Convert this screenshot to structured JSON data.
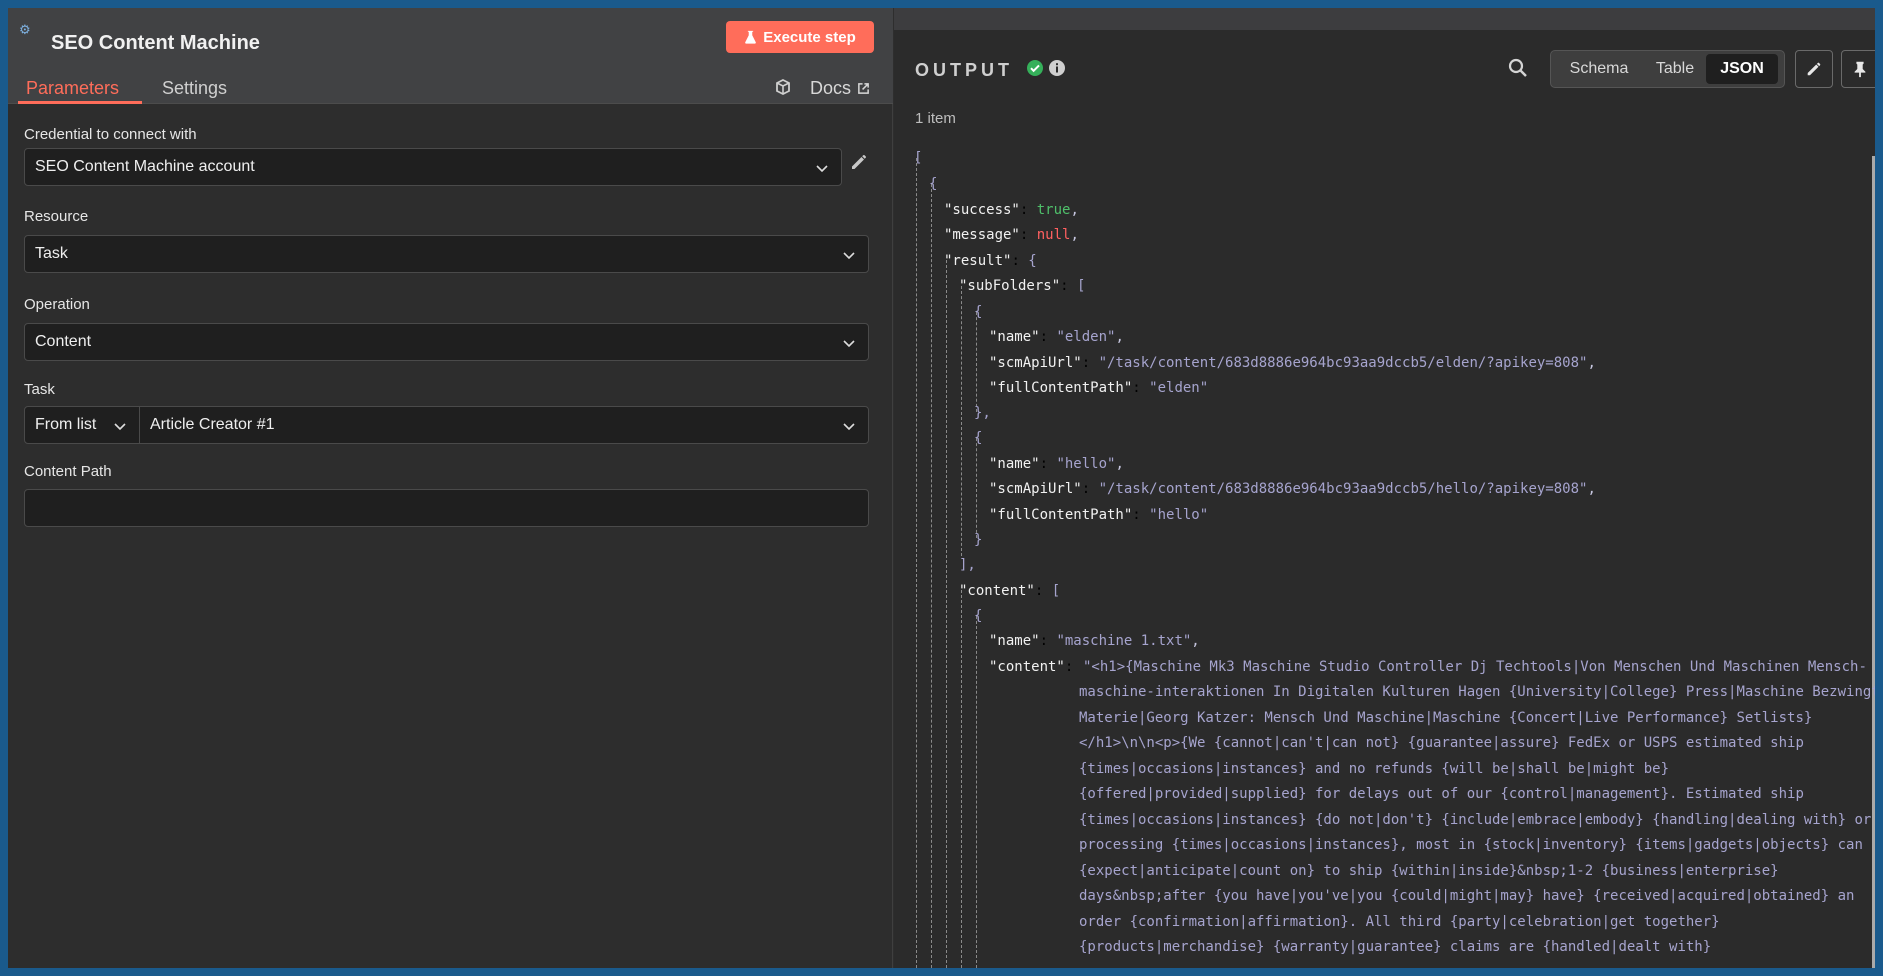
{
  "node": {
    "title": "SEO Content Machine",
    "execute_label": "Execute step",
    "tabs": [
      "Parameters",
      "Settings"
    ],
    "docs_label": "Docs"
  },
  "fields": {
    "credential_label": "Credential to connect with",
    "credential_value": "SEO Content Machine account",
    "resource_label": "Resource",
    "resource_value": "Task",
    "operation_label": "Operation",
    "operation_value": "Content",
    "task_label": "Task",
    "task_mode": "From list",
    "task_value": "Article Creator #1",
    "content_path_label": "Content Path",
    "content_path_value": ""
  },
  "output": {
    "title": "OUTPUT",
    "views": [
      "Schema",
      "Table",
      "JSON"
    ],
    "active_view": "JSON",
    "items_count": "1 item",
    "json": {
      "success": "true",
      "message": "null",
      "subFolders": [
        {
          "name": "\"elden\"",
          "scmApiUrl": "\"/task/content/683d8886e964bc93aa9dccb5/elden/?apikey=808\"",
          "fullContentPath": "\"elden\""
        },
        {
          "name": "\"hello\"",
          "scmApiUrl": "\"/task/content/683d8886e964bc93aa9dccb5/hello/?apikey=808\"",
          "fullContentPath": "\"hello\""
        }
      ],
      "content_name": "\"maschine 1.txt\"",
      "content_lines": [
        "\"<h1>{Maschine Mk3 Maschine Studio Controller Dj Techtools|Von Menschen Und Maschinen Mensch-",
        "maschine-interaktionen In Digitalen Kulturen Hagen {University|College} Press|Maschine Bezwingt",
        "Materie|Georg Katzer: Mensch Und Maschine|Maschine {Concert|Live Performance} Setlists}",
        "</h1>\\n\\n<p>{We {cannot|can't|can not} {guarantee|assure} FedEx or USPS estimated ship",
        "{times|occasions|instances} and no refunds {will be|shall be|might be}",
        "{offered|provided|supplied} for delays out of our {control|management}. Estimated ship",
        "{times|occasions|instances} {do not|don't} {include|embrace|embody} {handling|dealing with} or",
        "processing {times|occasions|instances}, most in {stock|inventory} {items|gadgets|objects} can",
        "{expect|anticipate|count on} to ship {within|inside}&nbsp;1-2 {business|enterprise}",
        "days&nbsp;after {you have|you've|you {could|might|may} have} {received|acquired|obtained} an",
        "order {confirmation|affirmation}. All third {party|celebration|get together}",
        "{products|merchandise} {warranty|guarantee} claims are {handled|dealt with}"
      ]
    }
  }
}
